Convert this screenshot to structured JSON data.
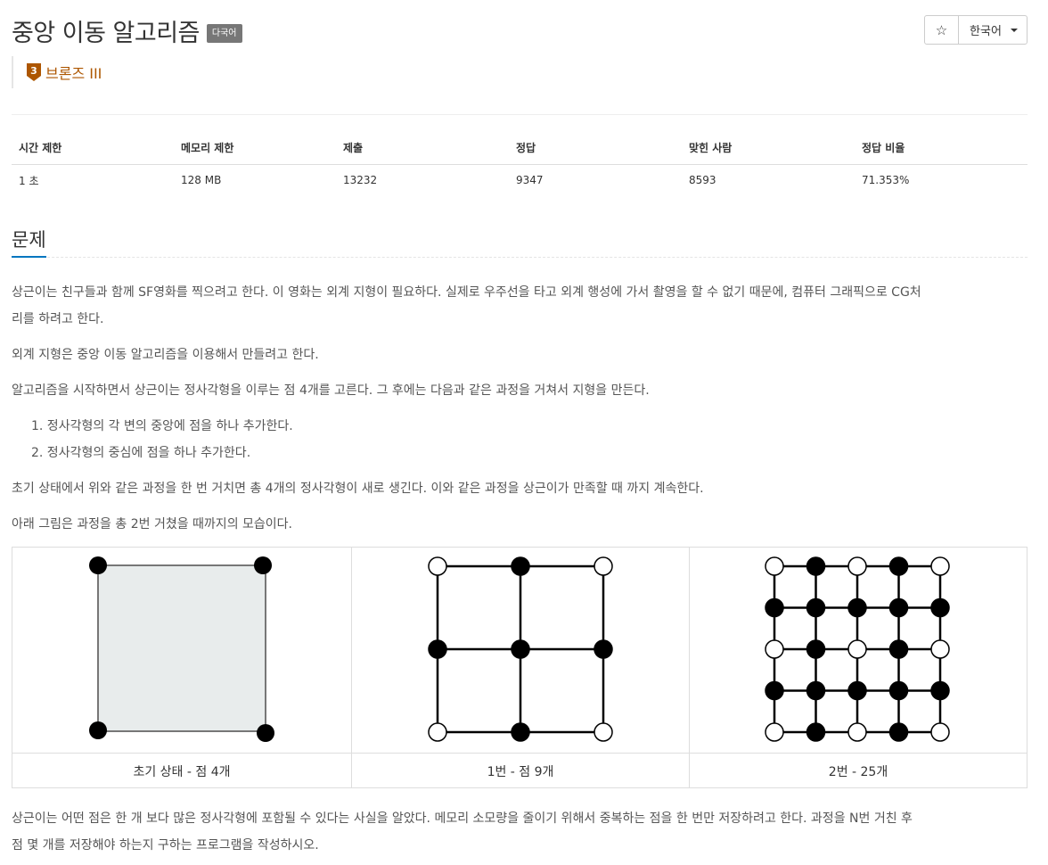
{
  "problem": {
    "title": "중앙 이동 알고리즘",
    "badge": "다국어",
    "tier_label": "브론즈 III",
    "tier_number": "3",
    "tier_color": "#ad5600"
  },
  "toolbar": {
    "star_icon": "star-icon",
    "language": "한국어"
  },
  "stats": {
    "headers": [
      "시간 제한",
      "메모리 제한",
      "제출",
      "정답",
      "맞힌 사람",
      "정답 비율"
    ],
    "values": [
      "1 초",
      "128 MB",
      "13232",
      "9347",
      "8593",
      "71.353%"
    ]
  },
  "section": {
    "title": "문제",
    "accent": "#0076c0"
  },
  "body": {
    "p1_line1": "상근이는 친구들과 함께 SF영화를 찍으려고 한다. 이 영화는 외계 지형이 필요하다. 실제로 우주선을 타고 외계 행성에 가서 촬영을 할 수 없기 때문에, 컴퓨터 그래픽으로 CG처",
    "p1_line2": "리를 하려고 한다.",
    "p2": "외계 지형은 중앙 이동 알고리즘을 이용해서 만들려고 한다.",
    "p3": "알고리즘을 시작하면서 상근이는 정사각형을 이루는 점 4개를 고른다. 그 후에는 다음과 같은 과정을 거쳐서 지형을 만든다.",
    "steps": [
      "1. 정사각형의 각 변의 중앙에 점을 하나 추가한다.",
      "2. 정사각형의 중심에 점을 하나 추가한다."
    ],
    "p4": "초기 상태에서 위와 같은 과정을 한 번 거치면 총 4개의 정사각형이 새로 생긴다. 이와 같은 과정을 상근이가 만족할 때 까지 계속한다.",
    "p5": "아래 그림은 과정을 총 2번 거쳤을 때까지의 모습이다.",
    "p6_line1": "상근이는 어떤 점은 한 개 보다 많은 정사각형에 포함될 수 있다는 사실을 알았다. 메모리 소모량을 줄이기 위해서 중복하는 점을 한 번만 저장하려고 한다. 과정을 N번 거친 후",
    "p6_line2": "점 몇 개를 저장해야 하는지 구하는 프로그램을 작성하시오."
  },
  "figures": {
    "captions": [
      "초기 상태 - 점 4개",
      "1번 - 점 9개",
      "2번 - 25개"
    ],
    "fill_color": "#e8ecec"
  }
}
